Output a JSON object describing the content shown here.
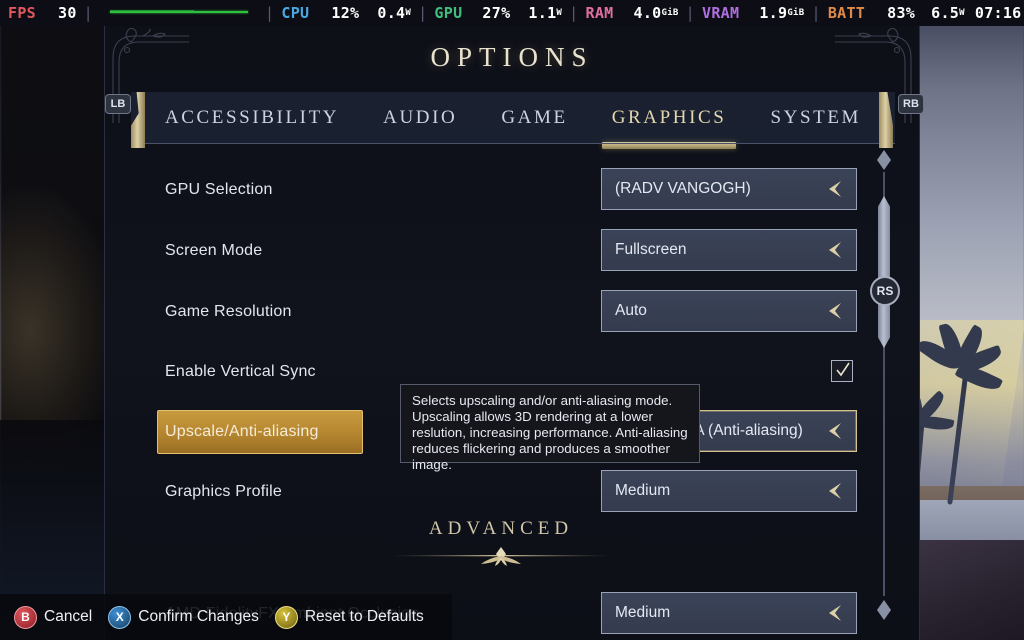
{
  "perf_overlay": {
    "fps_label": "FPS",
    "fps_value": "30",
    "cpu_label": "CPU",
    "cpu_usage": "12%",
    "cpu_power": "0.4",
    "cpu_power_unit": "W",
    "gpu_label": "GPU",
    "gpu_usage": "27%",
    "gpu_power": "1.1",
    "gpu_power_unit": "W",
    "ram_label": "RAM",
    "ram_value": "4.0",
    "ram_unit": "GiB",
    "vram_label": "VRAM",
    "vram_value": "1.9",
    "vram_unit": "GiB",
    "batt_label": "BATT",
    "batt_percent": "83%",
    "batt_power": "6.5",
    "batt_power_unit": "W",
    "clock": "07:16",
    "graph_color": "#2fbf3f"
  },
  "panel": {
    "title": "OPTIONS",
    "bumper_left": "LB",
    "bumper_right": "RB",
    "stick_right": "RS"
  },
  "tabs": [
    {
      "label": "ACCESSIBILITY",
      "active": false
    },
    {
      "label": "AUDIO",
      "active": false
    },
    {
      "label": "GAME",
      "active": false
    },
    {
      "label": "GRAPHICS",
      "active": true
    },
    {
      "label": "SYSTEM",
      "active": false
    }
  ],
  "settings": [
    {
      "label": "GPU Selection",
      "value": "(RADV VANGOGH)",
      "control": "dropdown",
      "selected": false
    },
    {
      "label": "Screen Mode",
      "value": "Fullscreen",
      "control": "dropdown",
      "selected": false
    },
    {
      "label": "Game Resolution",
      "value": "Auto",
      "control": "dropdown",
      "selected": false
    },
    {
      "label": "Enable Vertical Sync",
      "value": "checked",
      "control": "checkbox",
      "selected": false
    },
    {
      "label": "Upscale/Anti-aliasing",
      "value": "Auto - MSAA (Anti-aliasing)",
      "control": "dropdown",
      "selected": true
    },
    {
      "label": "Graphics Profile",
      "value": "Medium",
      "control": "dropdown",
      "selected": false
    }
  ],
  "section_divider": {
    "label": "ADVANCED"
  },
  "advanced_settings": [
    {
      "label": "AMD FidelityFX Ambient Occlusion",
      "value": "Medium",
      "control": "dropdown",
      "selected": false
    }
  ],
  "tooltip": {
    "text": "Selects upscaling and/or anti-aliasing mode. Upscaling allows 3D rendering at a lower reslution, increasing performance. Anti-aliasing reduces flickering and produces a smoother image."
  },
  "action_bar": [
    {
      "glyph": "B",
      "label": "Cancel",
      "color": "#d6454d"
    },
    {
      "glyph": "X",
      "label": "Confirm Changes",
      "color": "#3f8fd8"
    },
    {
      "glyph": "Y",
      "label": "Reset to Defaults",
      "color": "#d6c23a"
    }
  ],
  "theme": {
    "gold": "#d8cba4",
    "panel_bg": "#10121c",
    "selected_row": "#b5862f",
    "text": "#e2e6f0"
  }
}
